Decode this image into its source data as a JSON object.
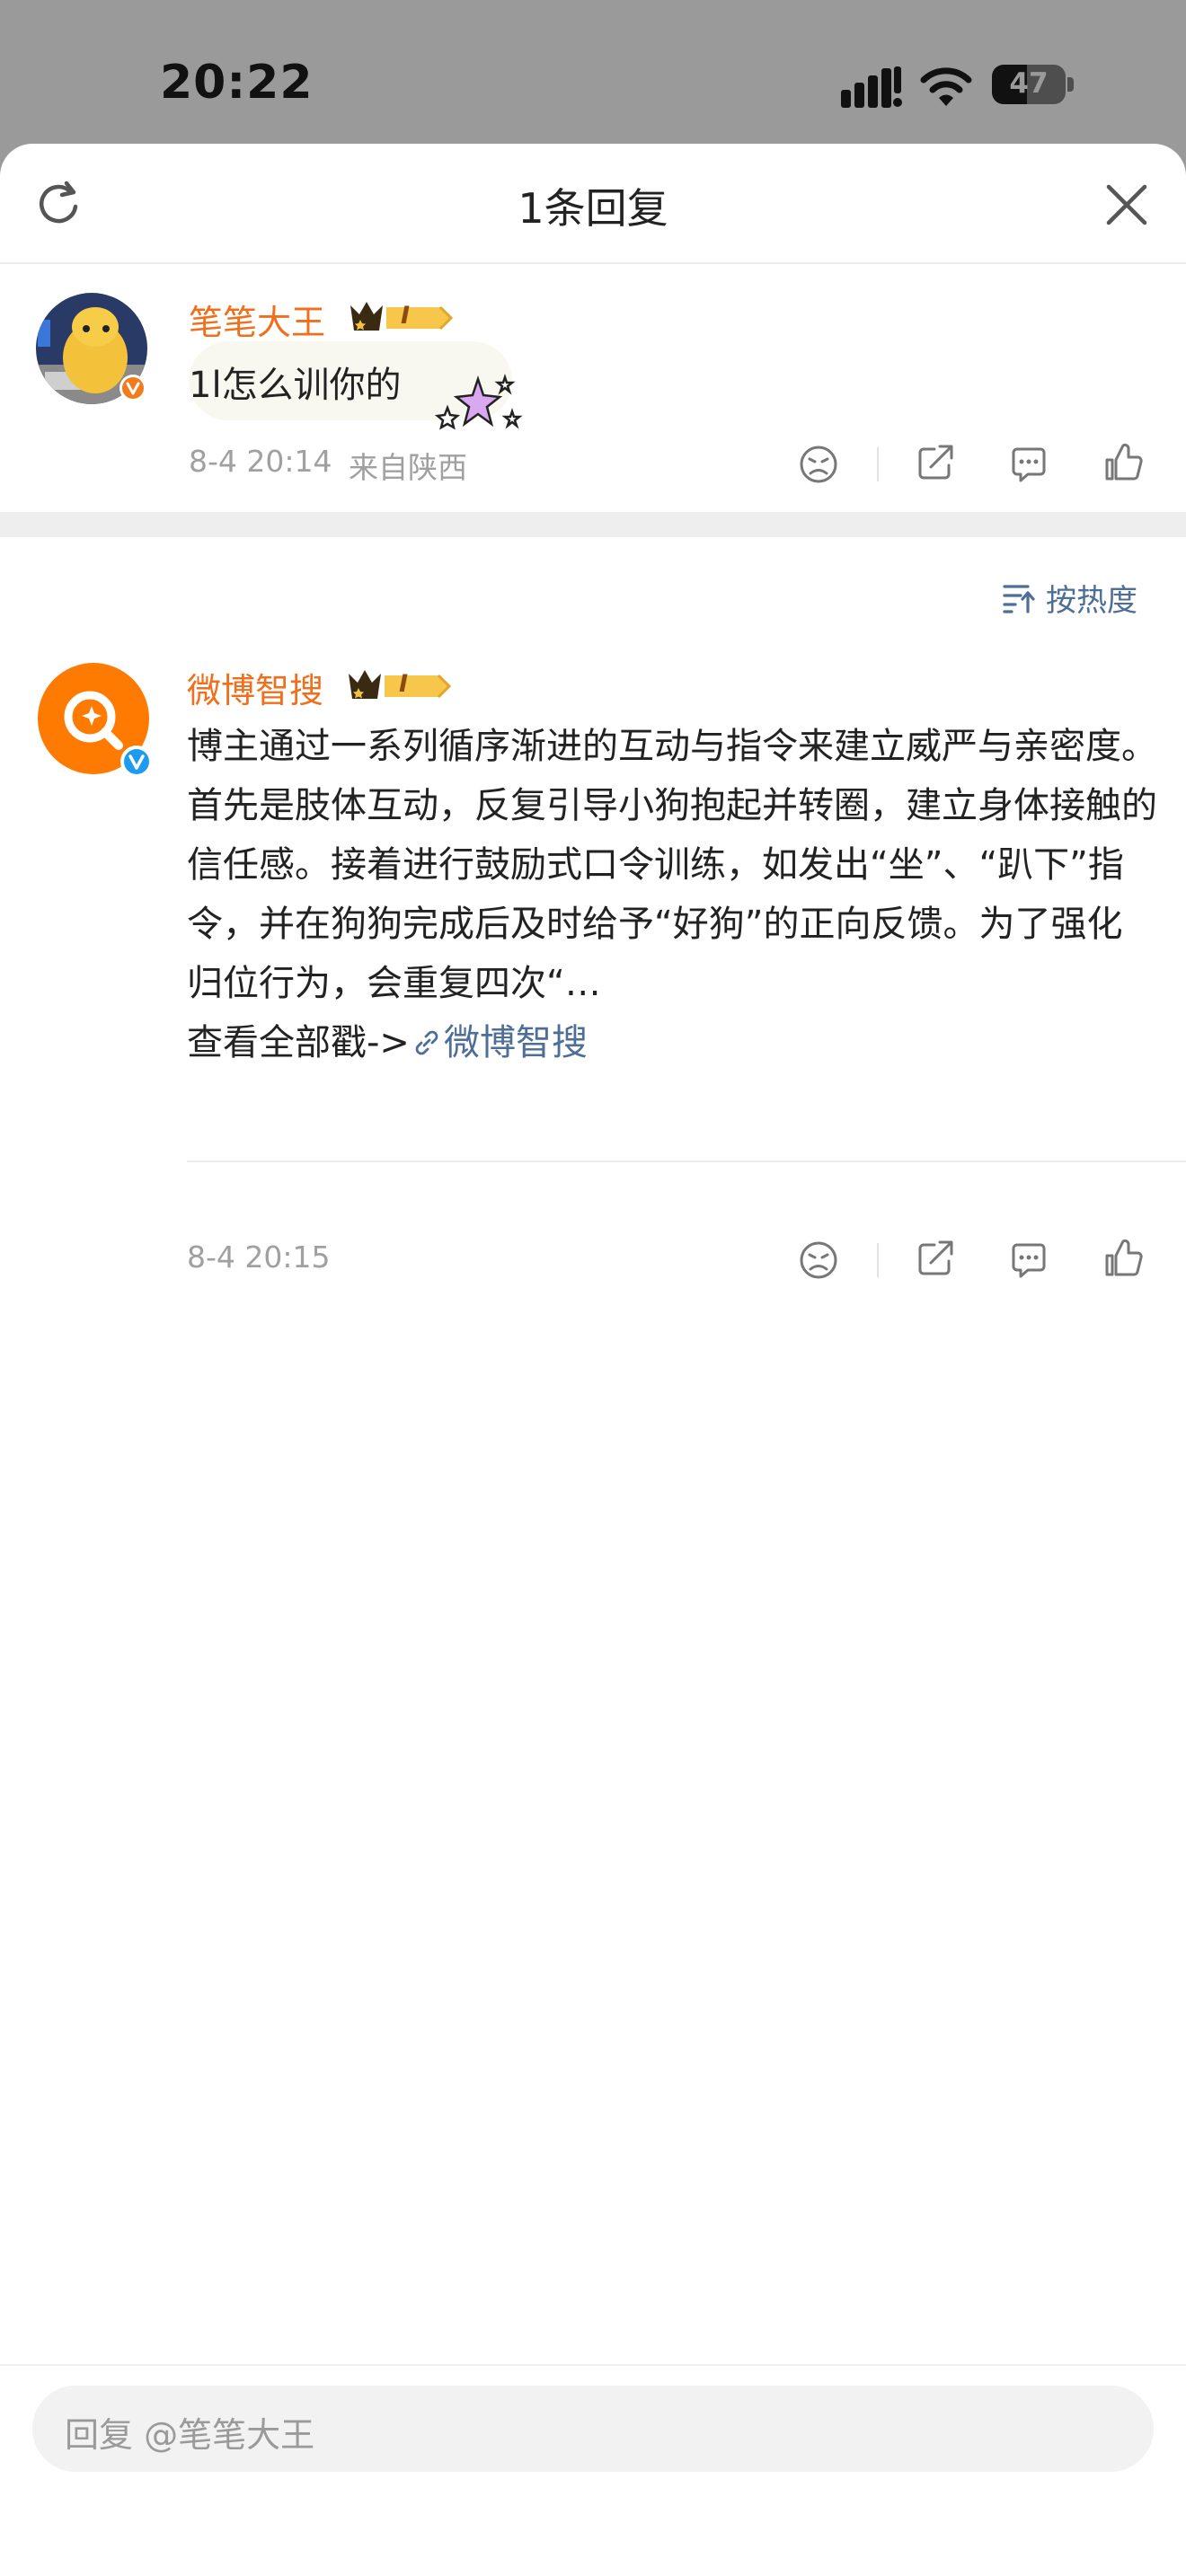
{
  "status_bar": {
    "time": "20:22",
    "battery": "47",
    "battery_level": 0.47
  },
  "header": {
    "title": "1条回复"
  },
  "comment": {
    "author": "笔笔大王",
    "level_badge": "I",
    "text": "1l怎么训你的",
    "date": "8-4 20:14",
    "location": "来自陕西"
  },
  "sort": {
    "label": "按热度"
  },
  "reply": {
    "author": "微博智搜",
    "level_badge": "I",
    "text": "博主通过一系列循序渐进的互动与指令来建立威严与亲密度。首先是肢体互动，反复引导小狗抱起并转圈，建立身体接触的信任感。接着进行鼓励式口令训练，如发出“坐”、“趴下”指令，并在狗狗完成后及时给予“好狗”的正向反馈。为了强化归位行为，会重复四次“…",
    "more_label": "查看全部戳->",
    "link_label": "微博智搜",
    "date": "8-4 20:15"
  },
  "input": {
    "placeholder": "回复 @笔笔大王"
  },
  "colors": {
    "name_orange": "#f06f1c",
    "link_blue": "#4d6e96",
    "weibo_orange": "#ff7a00",
    "verified_blue": "#1e9bf0"
  }
}
